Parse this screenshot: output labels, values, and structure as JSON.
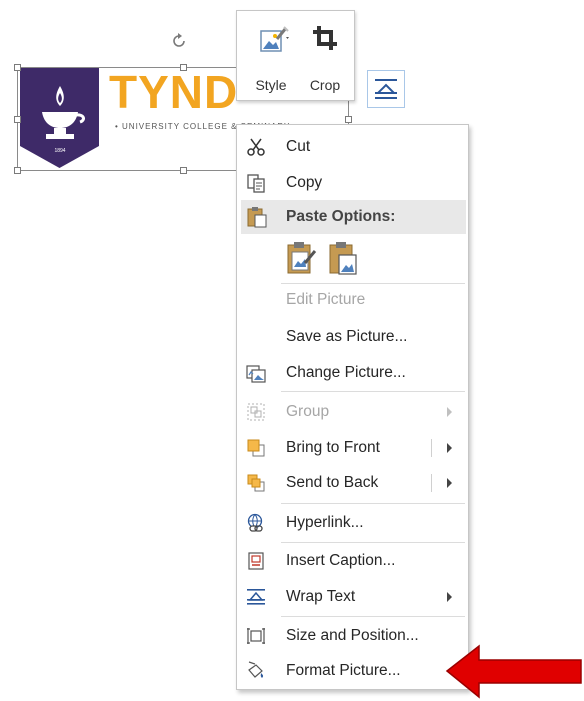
{
  "picture": {
    "brand_text": "TYND",
    "tagline": "• UNIVERSITY COLLEGE & SEMINARY",
    "shield_year": "1894"
  },
  "mini_toolbar": {
    "style_label": "Style",
    "crop_label": "Crop"
  },
  "context_menu": {
    "cut": "Cut",
    "copy": "Copy",
    "paste_options": "Paste Options:",
    "edit_picture": "Edit Picture",
    "save_as_picture": "Save as Picture...",
    "change_picture": "Change Picture...",
    "group": "Group",
    "bring_to_front": "Bring to Front",
    "send_to_back": "Send to Back",
    "hyperlink": "Hyperlink...",
    "insert_caption": "Insert Caption...",
    "wrap_text": "Wrap Text",
    "size_and_position": "Size and Position...",
    "format_picture": "Format Picture..."
  },
  "colors": {
    "brand_gold": "#f2a521",
    "shield_purple": "#3e2a68",
    "annotation_red": "#e00000"
  }
}
